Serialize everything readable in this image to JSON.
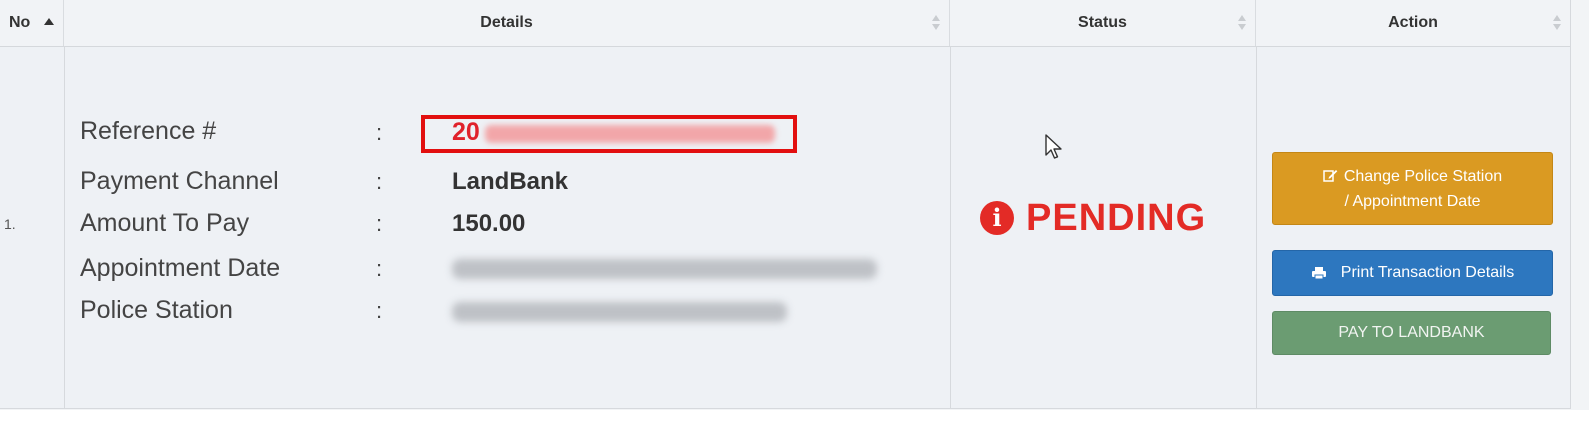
{
  "table": {
    "headers": {
      "no": "No",
      "details": "Details",
      "status": "Status",
      "action": "Action"
    }
  },
  "row": {
    "no": "1.",
    "labels": {
      "reference": "Reference #",
      "payment_channel": "Payment Channel",
      "amount_to_pay": "Amount To Pay",
      "appointment_date": "Appointment Date",
      "police_station": "Police Station"
    },
    "separator": ":",
    "reference_visible": "20",
    "payment_channel": "LandBank",
    "amount_to_pay": "150.00",
    "status": "PENDING",
    "status_icon": "info-circle-icon",
    "status_color": "#e32b26"
  },
  "actions": {
    "change_line1": "Change Police Station",
    "change_line2": "/ Appointment Date",
    "print": "Print Transaction Details",
    "pay": "PAY TO LANDBANK",
    "colors": {
      "change": "#da9a22",
      "print": "#2d77bf",
      "pay": "#6b9c72"
    }
  }
}
